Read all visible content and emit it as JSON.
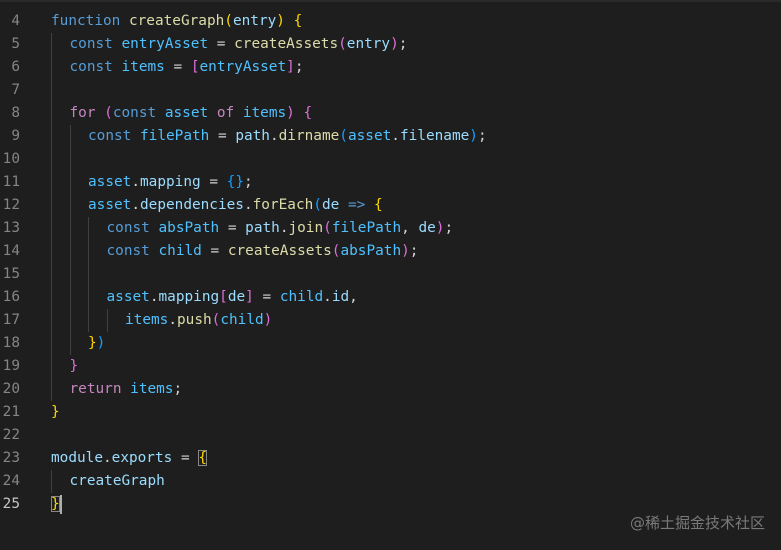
{
  "editor": {
    "theme_colors": {
      "background": "#1e1e1e",
      "keyword": "#569cd6",
      "control": "#c586c0",
      "function": "#dcdcaa",
      "variable": "#9cdcfe",
      "constant": "#4fc1ff",
      "plain": "#d4d4d4",
      "bracket_level_1": "#ffd700",
      "bracket_level_2": "#da70d6",
      "bracket_level_3": "#179fff"
    },
    "active_line": "25",
    "lines": [
      {
        "number": "4",
        "indent": 0,
        "tokens": [
          {
            "t": "function",
            "c": "kw"
          },
          {
            "t": " ",
            "c": "pl"
          },
          {
            "t": "createGraph",
            "c": "fn"
          },
          {
            "t": "(",
            "c": "br1"
          },
          {
            "t": "entry",
            "c": "var"
          },
          {
            "t": ")",
            "c": "br1"
          },
          {
            "t": " ",
            "c": "pl"
          },
          {
            "t": "{",
            "c": "br1"
          }
        ]
      },
      {
        "number": "5",
        "indent": 1,
        "tokens": [
          {
            "t": "const",
            "c": "kw"
          },
          {
            "t": " ",
            "c": "pl"
          },
          {
            "t": "entryAsset",
            "c": "cst"
          },
          {
            "t": " = ",
            "c": "pl"
          },
          {
            "t": "createAssets",
            "c": "fn"
          },
          {
            "t": "(",
            "c": "br2"
          },
          {
            "t": "entry",
            "c": "var"
          },
          {
            "t": ")",
            "c": "br2"
          },
          {
            "t": ";",
            "c": "pl"
          }
        ]
      },
      {
        "number": "6",
        "indent": 1,
        "tokens": [
          {
            "t": "const",
            "c": "kw"
          },
          {
            "t": " ",
            "c": "pl"
          },
          {
            "t": "items",
            "c": "cst"
          },
          {
            "t": " = ",
            "c": "pl"
          },
          {
            "t": "[",
            "c": "br2"
          },
          {
            "t": "entryAsset",
            "c": "cst"
          },
          {
            "t": "]",
            "c": "br2"
          },
          {
            "t": ";",
            "c": "pl"
          }
        ]
      },
      {
        "number": "7",
        "indent": 1,
        "tokens": []
      },
      {
        "number": "8",
        "indent": 1,
        "tokens": [
          {
            "t": "for",
            "c": "ctl"
          },
          {
            "t": " ",
            "c": "pl"
          },
          {
            "t": "(",
            "c": "br2"
          },
          {
            "t": "const",
            "c": "kw"
          },
          {
            "t": " ",
            "c": "pl"
          },
          {
            "t": "asset",
            "c": "cst"
          },
          {
            "t": " ",
            "c": "pl"
          },
          {
            "t": "of",
            "c": "ctl"
          },
          {
            "t": " ",
            "c": "pl"
          },
          {
            "t": "items",
            "c": "cst"
          },
          {
            "t": ")",
            "c": "br2"
          },
          {
            "t": " ",
            "c": "pl"
          },
          {
            "t": "{",
            "c": "br2"
          }
        ]
      },
      {
        "number": "9",
        "indent": 2,
        "tokens": [
          {
            "t": "const",
            "c": "kw"
          },
          {
            "t": " ",
            "c": "pl"
          },
          {
            "t": "filePath",
            "c": "cst"
          },
          {
            "t": " = ",
            "c": "pl"
          },
          {
            "t": "path",
            "c": "var"
          },
          {
            "t": ".",
            "c": "pl"
          },
          {
            "t": "dirname",
            "c": "fn"
          },
          {
            "t": "(",
            "c": "br3"
          },
          {
            "t": "asset",
            "c": "cst"
          },
          {
            "t": ".",
            "c": "pl"
          },
          {
            "t": "filename",
            "c": "var"
          },
          {
            "t": ")",
            "c": "br3"
          },
          {
            "t": ";",
            "c": "pl"
          }
        ]
      },
      {
        "number": "10",
        "indent": 2,
        "tokens": []
      },
      {
        "number": "11",
        "indent": 2,
        "tokens": [
          {
            "t": "asset",
            "c": "cst"
          },
          {
            "t": ".",
            "c": "pl"
          },
          {
            "t": "mapping",
            "c": "var"
          },
          {
            "t": " = ",
            "c": "pl"
          },
          {
            "t": "{}",
            "c": "br3"
          },
          {
            "t": ";",
            "c": "pl"
          }
        ]
      },
      {
        "number": "12",
        "indent": 2,
        "tokens": [
          {
            "t": "asset",
            "c": "cst"
          },
          {
            "t": ".",
            "c": "pl"
          },
          {
            "t": "dependencies",
            "c": "var"
          },
          {
            "t": ".",
            "c": "pl"
          },
          {
            "t": "forEach",
            "c": "fn"
          },
          {
            "t": "(",
            "c": "br3"
          },
          {
            "t": "de",
            "c": "var"
          },
          {
            "t": " ",
            "c": "pl"
          },
          {
            "t": "=>",
            "c": "kw"
          },
          {
            "t": " ",
            "c": "pl"
          },
          {
            "t": "{",
            "c": "br1"
          }
        ]
      },
      {
        "number": "13",
        "indent": 3,
        "tokens": [
          {
            "t": "const",
            "c": "kw"
          },
          {
            "t": " ",
            "c": "pl"
          },
          {
            "t": "absPath",
            "c": "cst"
          },
          {
            "t": " = ",
            "c": "pl"
          },
          {
            "t": "path",
            "c": "var"
          },
          {
            "t": ".",
            "c": "pl"
          },
          {
            "t": "join",
            "c": "fn"
          },
          {
            "t": "(",
            "c": "br2"
          },
          {
            "t": "filePath",
            "c": "cst"
          },
          {
            "t": ", ",
            "c": "pl"
          },
          {
            "t": "de",
            "c": "var"
          },
          {
            "t": ")",
            "c": "br2"
          },
          {
            "t": ";",
            "c": "pl"
          }
        ]
      },
      {
        "number": "14",
        "indent": 3,
        "tokens": [
          {
            "t": "const",
            "c": "kw"
          },
          {
            "t": " ",
            "c": "pl"
          },
          {
            "t": "child",
            "c": "cst"
          },
          {
            "t": " = ",
            "c": "pl"
          },
          {
            "t": "createAssets",
            "c": "fn"
          },
          {
            "t": "(",
            "c": "br2"
          },
          {
            "t": "absPath",
            "c": "cst"
          },
          {
            "t": ")",
            "c": "br2"
          },
          {
            "t": ";",
            "c": "pl"
          }
        ]
      },
      {
        "number": "15",
        "indent": 3,
        "tokens": []
      },
      {
        "number": "16",
        "indent": 3,
        "tokens": [
          {
            "t": "asset",
            "c": "cst"
          },
          {
            "t": ".",
            "c": "pl"
          },
          {
            "t": "mapping",
            "c": "var"
          },
          {
            "t": "[",
            "c": "br2"
          },
          {
            "t": "de",
            "c": "var"
          },
          {
            "t": "]",
            "c": "br2"
          },
          {
            "t": " = ",
            "c": "pl"
          },
          {
            "t": "child",
            "c": "cst"
          },
          {
            "t": ".",
            "c": "pl"
          },
          {
            "t": "id",
            "c": "var"
          },
          {
            "t": ",",
            "c": "pl"
          }
        ]
      },
      {
        "number": "17",
        "indent": 4,
        "tokens": [
          {
            "t": "items",
            "c": "cst"
          },
          {
            "t": ".",
            "c": "pl"
          },
          {
            "t": "push",
            "c": "fn"
          },
          {
            "t": "(",
            "c": "br2"
          },
          {
            "t": "child",
            "c": "cst"
          },
          {
            "t": ")",
            "c": "br2"
          }
        ]
      },
      {
        "number": "18",
        "indent": 2,
        "tokens": [
          {
            "t": "}",
            "c": "br1"
          },
          {
            "t": ")",
            "c": "br3"
          }
        ]
      },
      {
        "number": "19",
        "indent": 1,
        "tokens": [
          {
            "t": "}",
            "c": "br2"
          }
        ]
      },
      {
        "number": "20",
        "indent": 1,
        "tokens": [
          {
            "t": "return",
            "c": "ctl"
          },
          {
            "t": " ",
            "c": "pl"
          },
          {
            "t": "items",
            "c": "cst"
          },
          {
            "t": ";",
            "c": "pl"
          }
        ]
      },
      {
        "number": "21",
        "indent": 0,
        "tokens": [
          {
            "t": "}",
            "c": "br1"
          }
        ]
      },
      {
        "number": "22",
        "indent": 0,
        "tokens": []
      },
      {
        "number": "23",
        "indent": 0,
        "tokens": [
          {
            "t": "module",
            "c": "var"
          },
          {
            "t": ".",
            "c": "pl"
          },
          {
            "t": "exports",
            "c": "var"
          },
          {
            "t": " = ",
            "c": "pl"
          },
          {
            "t": "{",
            "c": "br1",
            "m": true
          }
        ]
      },
      {
        "number": "24",
        "indent": 1,
        "tokens": [
          {
            "t": "createGraph",
            "c": "var"
          }
        ]
      },
      {
        "number": "25",
        "indent": 0,
        "tokens": [
          {
            "t": "}",
            "c": "br1",
            "m": true
          }
        ]
      }
    ]
  },
  "watermark": "@稀土掘金技术社区"
}
